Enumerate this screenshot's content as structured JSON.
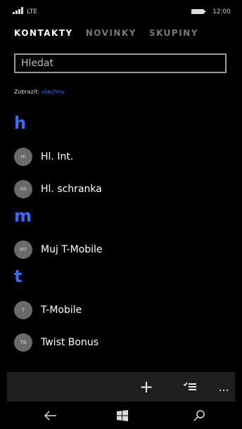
{
  "status": {
    "network": "LTE",
    "time": "12:00"
  },
  "pivots": [
    "KONTAKTY",
    "NOVINKY",
    "SKUPINY"
  ],
  "search": {
    "placeholder": "Hledat"
  },
  "filter": {
    "label": "Zobrazit:",
    "value": "všechny"
  },
  "groups": [
    {
      "letter": "h",
      "items": [
        {
          "initials": "HI",
          "name": "Hl. Int."
        },
        {
          "initials": "HS",
          "name": "Hl. schranka"
        }
      ]
    },
    {
      "letter": "m",
      "items": [
        {
          "initials": "MT",
          "name": "Muj T-Mobile"
        }
      ]
    },
    {
      "letter": "t",
      "items": [
        {
          "initials": "T",
          "name": "T-Mobile"
        },
        {
          "initials": "TB",
          "name": "Twist Bonus"
        }
      ]
    }
  ],
  "appbar": {
    "add": "+",
    "more": "..."
  },
  "colors": {
    "accent": "#3b6cf0",
    "appbar": "#1f1f1f"
  }
}
